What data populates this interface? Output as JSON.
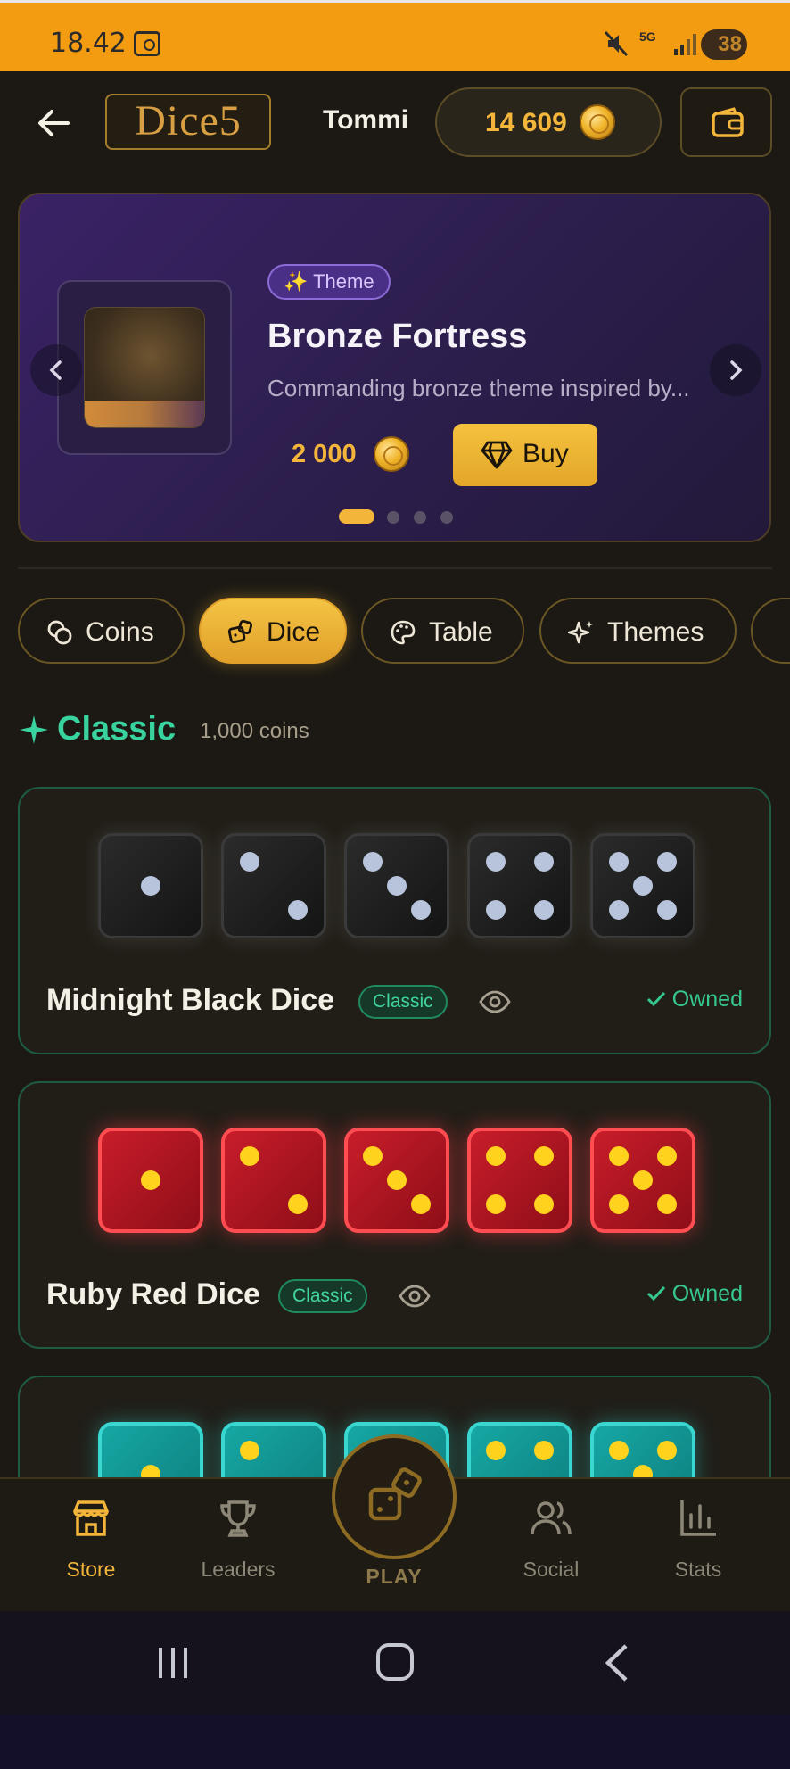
{
  "status_bar": {
    "time": "18.42",
    "network": "5G",
    "battery": "38"
  },
  "header": {
    "logo_text": "Dice5",
    "user_name": "Tommi",
    "balance": "14 609"
  },
  "promo": {
    "tag": "✨ Theme",
    "title": "Bronze Fortress",
    "description": "Commanding bronze theme inspired by...",
    "price": "2 000",
    "buy_label": "Buy",
    "slide_count": 4,
    "active_slide": 1
  },
  "tabs": [
    {
      "label": "Coins",
      "icon": "coins-icon",
      "active": false
    },
    {
      "label": "Dice",
      "icon": "dice-icon",
      "active": true
    },
    {
      "label": "Table",
      "icon": "palette-icon",
      "active": false
    },
    {
      "label": "Themes",
      "icon": "sparkles-icon",
      "active": false
    }
  ],
  "section": {
    "title": "Classic",
    "subtitle": "1,000 coins"
  },
  "cards": [
    {
      "name": "Midnight Black Dice",
      "badge": "Classic",
      "status": "Owned",
      "style": "black"
    },
    {
      "name": "Ruby Red Dice",
      "badge": "Classic",
      "status": "Owned",
      "style": "red"
    },
    {
      "name": "",
      "badge": "",
      "status": "",
      "style": "teal"
    }
  ],
  "nav": {
    "items": [
      {
        "label": "Store",
        "icon": "store-icon",
        "active": true
      },
      {
        "label": "Leaders",
        "icon": "trophy-icon",
        "active": false
      },
      {
        "label": "Social",
        "icon": "users-icon",
        "active": false
      },
      {
        "label": "Stats",
        "icon": "bar-chart-icon",
        "active": false
      }
    ],
    "play_label": "PLAY"
  },
  "colors": {
    "accent": "#f3b63a",
    "status_bar": "#f39c12",
    "success": "#38d39f",
    "background": "#1c1914"
  }
}
